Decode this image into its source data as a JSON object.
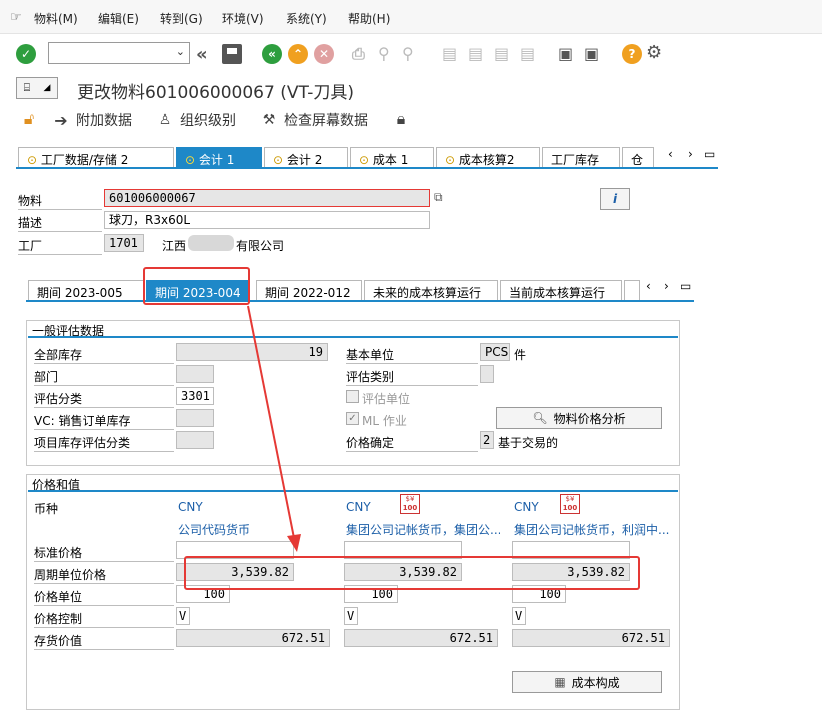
{
  "menu": [
    "物料(M)",
    "编辑(E)",
    "转到(G)",
    "环境(V)",
    "系统(Y)",
    "帮助(H)"
  ],
  "title": "更改物料601006000067 (VT-刀具)",
  "app_toolbar": {
    "additional_data": "附加数据",
    "org_levels": "组织级别",
    "check_screen": "检查屏幕数据"
  },
  "main_tabs": [
    "工厂数据/存储 2",
    "会计 1",
    "会计 2",
    "成本 1",
    "成本核算2",
    "工厂库存",
    "仓"
  ],
  "header": {
    "material_label": "物料",
    "material_value": "601006000067",
    "desc_label": "描述",
    "desc_value": "球刀，R3x60L",
    "plant_label": "工厂",
    "plant_value": "1701",
    "plant_name_prefix": "江西",
    "plant_name_suffix": "有限公司"
  },
  "period_tabs": [
    "期间 2023-005",
    "期间 2023-004",
    "期间 2022-012",
    "未来的成本核算运行",
    "当前成本核算运行"
  ],
  "general_valuation": {
    "title": "一般评估数据",
    "total_stock_label": "全部库存",
    "total_stock_value": "19",
    "base_unit_label": "基本单位",
    "base_unit_value": "PCS",
    "base_unit_text": "件",
    "division_label": "部门",
    "valuation_category_label": "评估类别",
    "valuation_class_label": "评估分类",
    "valuation_class_value": "3301",
    "valuated_unit_label": "评估单位",
    "vc_label": "VC: 销售订单库存",
    "ml_label": "ML 作业",
    "project_label": "项目库存评估分类",
    "price_determination_label": "价格确定",
    "price_determination_value": "2",
    "price_determination_text": "基于交易的",
    "price_analysis_button": "物料价格分析"
  },
  "prices": {
    "title": "价格和值",
    "currency_label": "币种",
    "std_price_label": "标准价格",
    "periodic_price_label": "周期单位价格",
    "price_unit_label": "价格单位",
    "price_control_label": "价格控制",
    "inventory_value_label": "存货价值",
    "cost_estimate_button": "成本构成",
    "columns": [
      {
        "currency": "CNY",
        "desc": "公司代码货币",
        "periodic_price": "3,539.82",
        "price_unit": "100",
        "price_control": "V",
        "inventory_value": "672.51"
      },
      {
        "currency": "CNY",
        "desc": "集团公司记帐货币，集团公...",
        "periodic_price": "3,539.82",
        "price_unit": "100",
        "price_control": "V",
        "inventory_value": "672.51"
      },
      {
        "currency": "CNY",
        "desc": "集团公司记帐货币，利润中...",
        "periodic_price": "3,539.82",
        "price_unit": "100",
        "price_control": "V",
        "inventory_value": "672.51"
      }
    ]
  },
  "colors": {
    "accent": "#1e88c8",
    "highlight": "#e53935"
  }
}
